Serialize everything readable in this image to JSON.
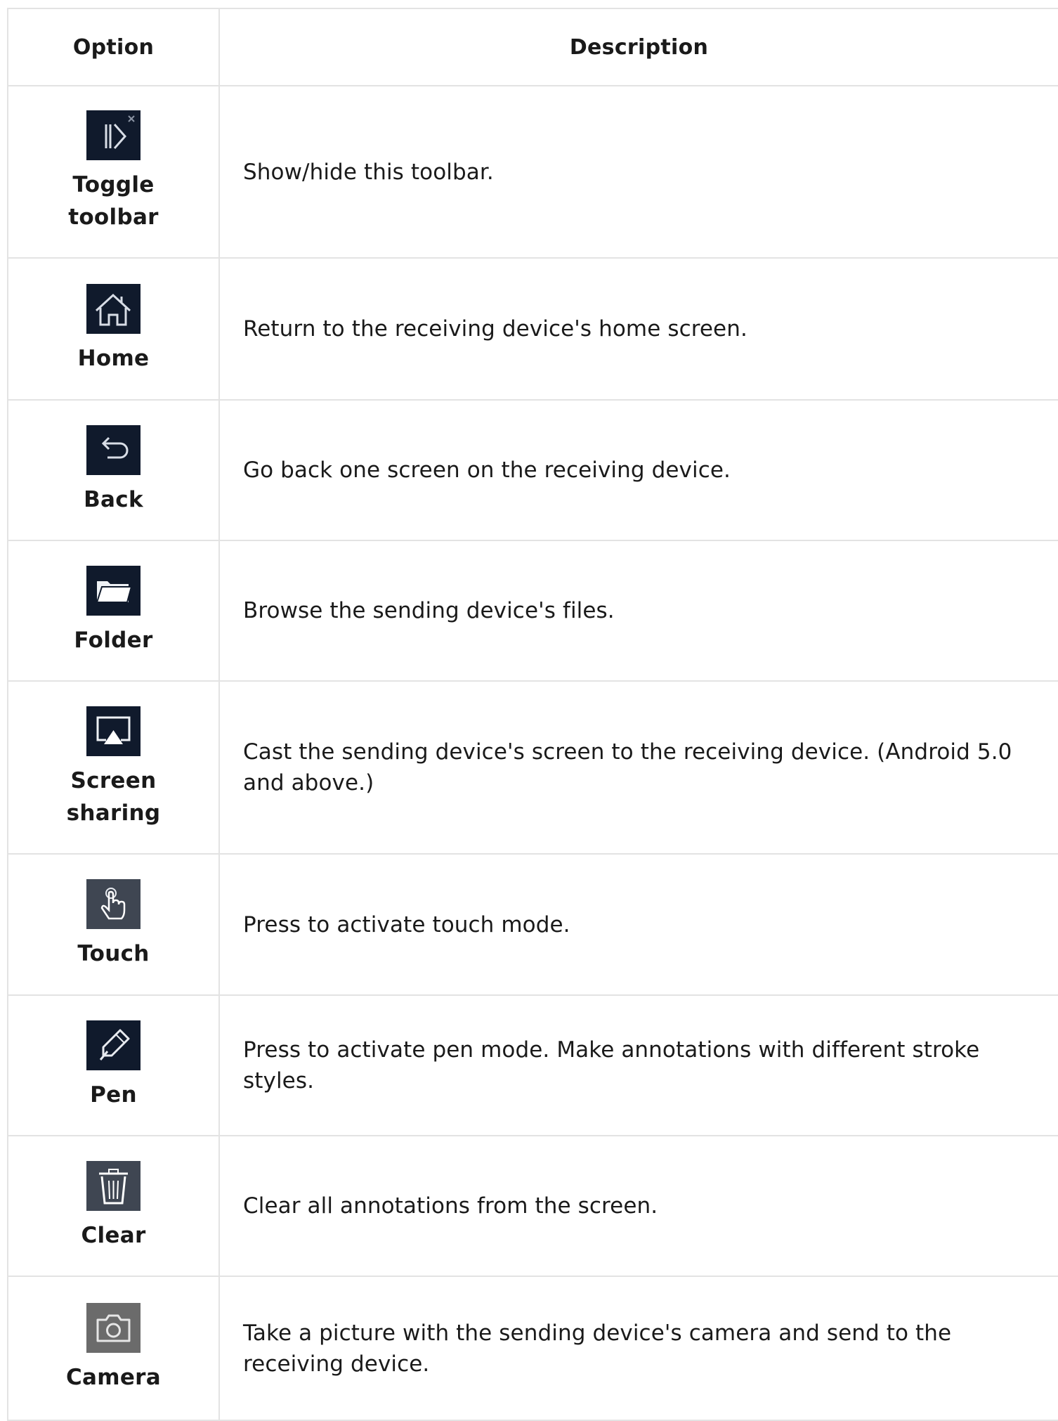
{
  "table": {
    "headers": {
      "option": "Option",
      "description": "Description"
    },
    "rows": [
      {
        "icon": "toggle-toolbar-icon",
        "label": "Toggle toolbar",
        "description": "Show/hide this toolbar."
      },
      {
        "icon": "home-icon",
        "label": "Home",
        "description": "Return to the receiving device's home screen."
      },
      {
        "icon": "back-arrow-icon",
        "label": "Back",
        "description": "Go back one screen on the receiving device."
      },
      {
        "icon": "folder-icon",
        "label": "Folder",
        "description": "Browse the sending device's files."
      },
      {
        "icon": "screen-sharing-icon",
        "label": "Screen sharing",
        "description": "Cast the sending device's screen to the receiving device. (Android 5.0 and above.)"
      },
      {
        "icon": "touch-hand-icon",
        "label": "Touch",
        "description": "Press to activate touch mode."
      },
      {
        "icon": "pen-icon",
        "label": "Pen",
        "description": "Press to activate pen mode. Make annotations with different stroke styles."
      },
      {
        "icon": "trash-icon",
        "label": "Clear",
        "description": "Clear all annotations from the screen."
      },
      {
        "icon": "camera-icon",
        "label": "Camera",
        "description": "Take a picture with the sending device's camera and send to the receiving device."
      }
    ]
  },
  "colors": {
    "icon_background": "#101a2c",
    "border": "#e3e3e3",
    "text": "#1a1a1a"
  }
}
